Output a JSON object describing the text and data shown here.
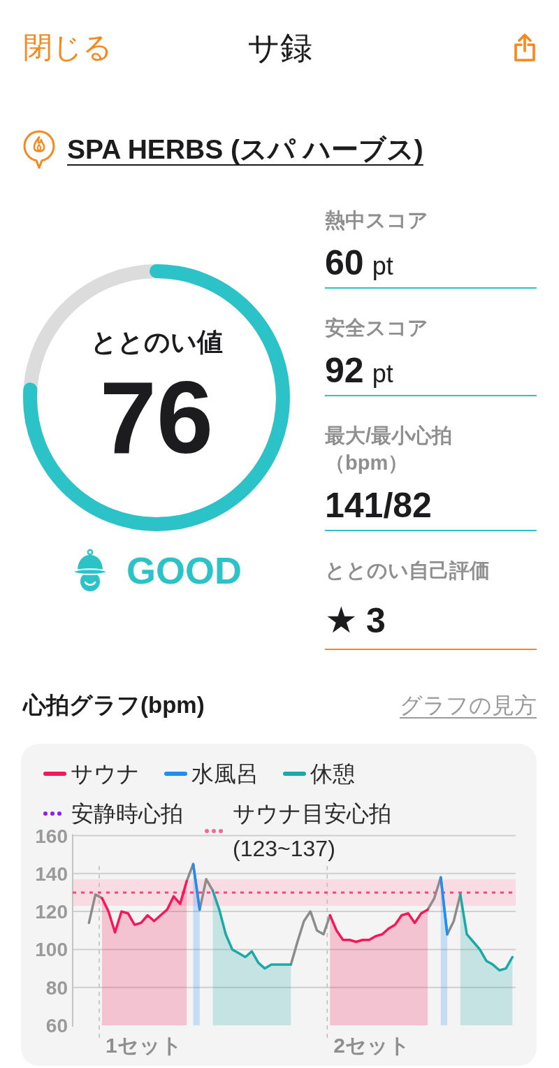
{
  "header": {
    "close": "閉じる",
    "title": "サ録"
  },
  "venue": {
    "name": "SPA HERBS (スパ ハーブス)"
  },
  "gauge": {
    "label": "ととのい値",
    "value": "76",
    "level": 0.76,
    "grade": "GOOD"
  },
  "stats": [
    {
      "kind": "score",
      "label": "熱中スコア",
      "value": "60",
      "unit": "pt"
    },
    {
      "kind": "score",
      "label": "安全スコア",
      "value": "92",
      "unit": "pt"
    },
    {
      "kind": "score",
      "label": "最大/最小心拍",
      "label_note": "（bpm）",
      "value": "141/82"
    },
    {
      "kind": "rating",
      "label": "ととのい自己評価",
      "star": "★",
      "value": "3"
    }
  ],
  "heart_chart": {
    "title": "心拍グラフ(bpm)",
    "help_link": "グラフの見方",
    "legend_refs": [
      {
        "label": "安静時心拍",
        "color": "#8f1fe6"
      },
      {
        "label": "サウナ目安心拍",
        "note": "(123~137)",
        "color": "#f26a98"
      }
    ],
    "set_labels": [
      "1セット",
      "2セット"
    ],
    "chart_data": {
      "type": "area",
      "ylim": [
        60,
        160
      ],
      "yticks": [
        60,
        80,
        100,
        120,
        140,
        160
      ],
      "grid": true,
      "series": [
        {
          "type": "line",
          "color": "#8c8c8c",
          "values": [
            null,
            null,
            114,
            129,
            127,
            null,
            null,
            null,
            null,
            null,
            null,
            null,
            null,
            null,
            null,
            null,
            null,
            136,
            145,
            121,
            137,
            131,
            null,
            null,
            null,
            null,
            null,
            null,
            null,
            null,
            null,
            null,
            null,
            92,
            104,
            115,
            120,
            110,
            108,
            118,
            null,
            null,
            null,
            null,
            null,
            null,
            null,
            null,
            null,
            null,
            null,
            null,
            null,
            null,
            121,
            127,
            138,
            108,
            115,
            129,
            null,
            null,
            null,
            null,
            null,
            null,
            null,
            null
          ]
        },
        {
          "name": "サウナ",
          "color": "#f2185a",
          "values": [
            null,
            null,
            null,
            null,
            127,
            120,
            109,
            120,
            119,
            113,
            114,
            118,
            115,
            118,
            121,
            128,
            124,
            136,
            null,
            null,
            null,
            null,
            null,
            null,
            null,
            null,
            null,
            null,
            null,
            null,
            null,
            null,
            null,
            null,
            null,
            null,
            null,
            null,
            null,
            118,
            110,
            105,
            105,
            104,
            105,
            105,
            107,
            108,
            111,
            113,
            118,
            119,
            114,
            119,
            121,
            null,
            null,
            null,
            null,
            null,
            null,
            null,
            null,
            null,
            null,
            null,
            null,
            null
          ]
        },
        {
          "name": "水風呂",
          "color": "#1e8ef0",
          "values": [
            null,
            null,
            null,
            null,
            null,
            null,
            null,
            null,
            null,
            null,
            null,
            null,
            null,
            null,
            null,
            null,
            null,
            null,
            145,
            121,
            null,
            null,
            null,
            null,
            null,
            null,
            null,
            null,
            null,
            null,
            null,
            null,
            null,
            null,
            null,
            null,
            null,
            null,
            null,
            null,
            null,
            null,
            null,
            null,
            null,
            null,
            null,
            null,
            null,
            null,
            null,
            null,
            null,
            null,
            null,
            null,
            138,
            108,
            null,
            null,
            null,
            null,
            null,
            null,
            null,
            null,
            null,
            null
          ]
        },
        {
          "name": "休憩",
          "color": "#1aa9a5",
          "values": [
            null,
            null,
            null,
            null,
            null,
            null,
            null,
            null,
            null,
            null,
            null,
            null,
            null,
            null,
            null,
            null,
            null,
            null,
            null,
            null,
            null,
            131,
            121,
            108,
            100,
            98,
            96,
            99,
            93,
            90,
            92,
            92,
            92,
            92,
            null,
            null,
            null,
            null,
            null,
            null,
            null,
            null,
            null,
            null,
            null,
            null,
            null,
            null,
            null,
            null,
            null,
            null,
            null,
            null,
            null,
            null,
            null,
            null,
            null,
            129,
            108,
            104,
            100,
            94,
            92,
            89,
            90,
            96
          ]
        }
      ],
      "bands": [
        {
          "axis": "y",
          "from": 123,
          "to": 137,
          "color": "#f9dbe4"
        }
      ],
      "ref_lines": [
        {
          "axis": "y",
          "value": 130,
          "color": "#f5457a"
        }
      ]
    }
  }
}
